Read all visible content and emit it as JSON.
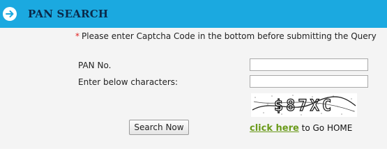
{
  "header": {
    "title": "PAN SEARCH",
    "icon": "arrow-right-circle-icon",
    "background": "#1ba9e0"
  },
  "notice": {
    "required_mark": "*",
    "text": "Please enter Captcha Code in the bottom before submitting the Query"
  },
  "form": {
    "pan_label": "PAN No.",
    "pan_value": "",
    "captcha_label": "Enter below characters:",
    "captcha_value": "",
    "captcha_text": "$87XC"
  },
  "actions": {
    "search_label": "Search Now",
    "home_link_text": "click here",
    "home_suffix": "to Go HOME",
    "link_color": "#6a9a1a"
  }
}
